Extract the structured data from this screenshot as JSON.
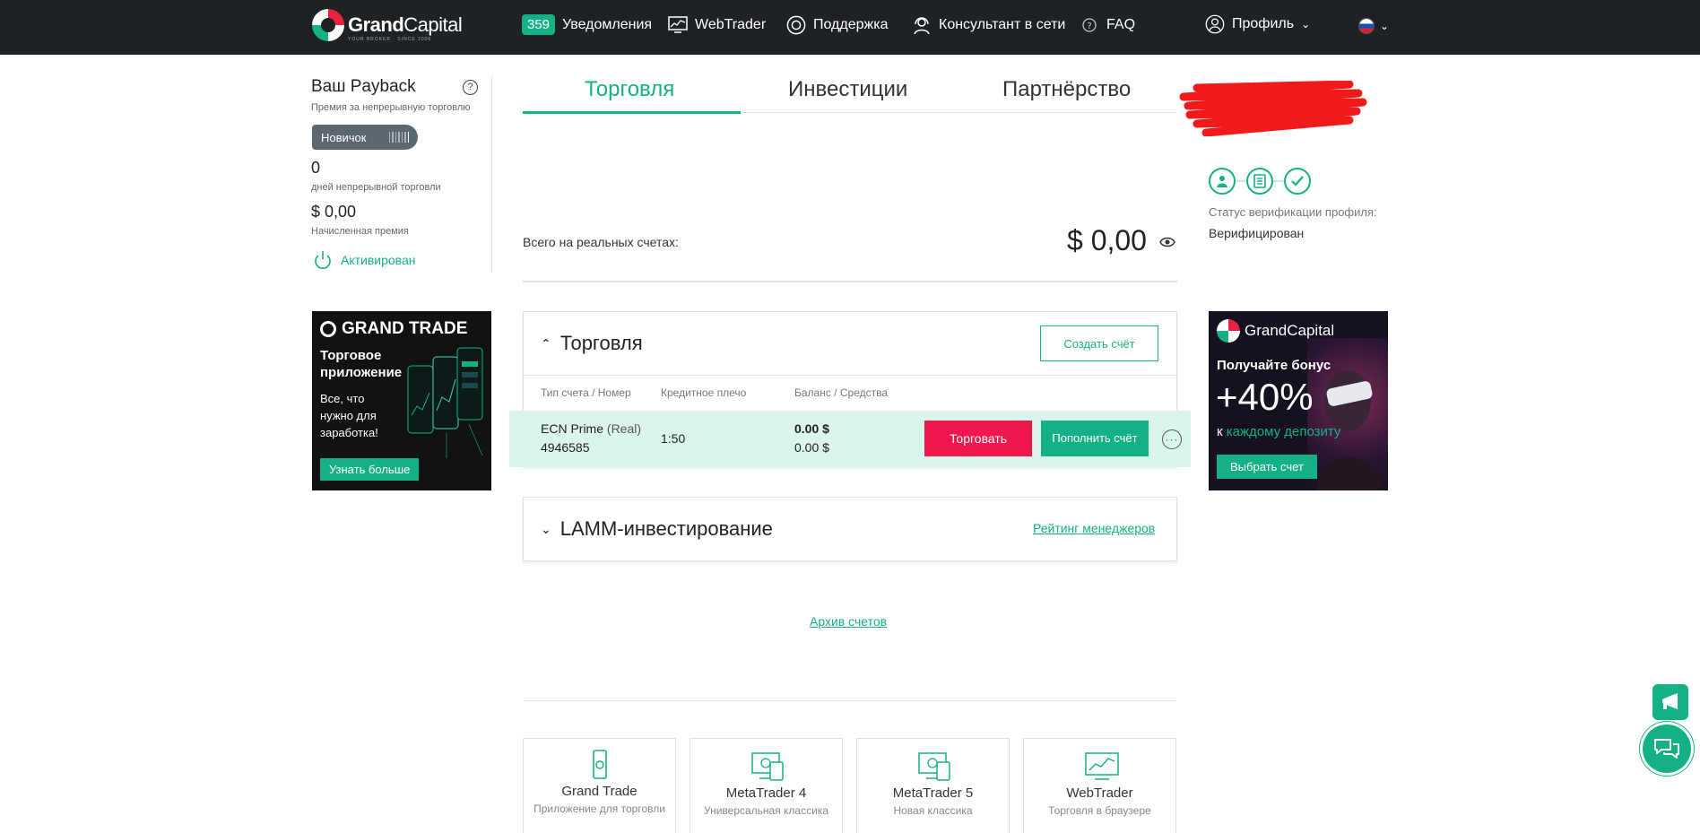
{
  "header": {
    "logo_main": "Grand",
    "logo_thin": "Capital",
    "logo_sub": "YOUR BROKER · SINCE 2006",
    "notifications_count": "359",
    "notifications_label": "Уведомления",
    "webtrader_label": "WebTrader",
    "support_label": "Поддержка",
    "consultant_label": "Консультант в сети",
    "faq_label": "FAQ",
    "profile_label": "Профиль"
  },
  "payback": {
    "title": "Ваш Payback",
    "help": "?",
    "subtitle": "Премия за непрерывную торговлю",
    "level": "Новичок",
    "days_value": "0",
    "days_label": "дней непрерывной торговли",
    "premium_value": "$ 0,00",
    "premium_label": "Начисленная премия",
    "status": "Активирован"
  },
  "banner_left": {
    "brand": "GRAND TRADE",
    "heading": "Торговое приложение",
    "text": "Все, что нужно для заработка!",
    "button": "Узнать больше"
  },
  "banner_right": {
    "brand": "GrandCapital",
    "heading": "Получайте бонус",
    "big": "+40%",
    "text_prefix": "к",
    "text_accent": "каждому депозиту",
    "button": "Выбрать счет"
  },
  "tabs": [
    {
      "label": "Торговля",
      "active": true
    },
    {
      "label": "Инвестиции",
      "active": false
    },
    {
      "label": "Партнёрство",
      "active": false
    }
  ],
  "verification": {
    "label": "Статус верификации профиля:",
    "value": "Верифицирован"
  },
  "total": {
    "label": "Всего на реальных счетах:",
    "amount": "$ 0,00"
  },
  "trading_panel": {
    "title": "Торговля",
    "create_button": "Создать счёт",
    "columns": [
      "Тип счета / Номер",
      "Кредитное плечо",
      "Баланс / Средства"
    ],
    "account": {
      "type": "ECN Prime",
      "mode": "(Real)",
      "number": "4946585",
      "leverage": "1:50",
      "balance": "0.00 $",
      "equity": "0.00 $",
      "trade_button": "Торговать",
      "deposit_button": "Пополнить счёт"
    }
  },
  "lamm_panel": {
    "title": "LAMM-инвестирование",
    "link": "Рейтинг менеджеров"
  },
  "archive_link": "Архив счетов",
  "platforms": [
    {
      "title": "Grand Trade",
      "subtitle": "Приложение для торговли"
    },
    {
      "title": "MetaTrader 4",
      "subtitle": "Универсальная классика"
    },
    {
      "title": "MetaTrader 5",
      "subtitle": "Новая классика"
    },
    {
      "title": "WebTrader",
      "subtitle": "Торговля в браузере"
    }
  ],
  "colors": {
    "accent": "#14b184",
    "header_bg": "#1f2225",
    "danger": "#f0174e",
    "row_highlight": "#d9f5ec"
  }
}
